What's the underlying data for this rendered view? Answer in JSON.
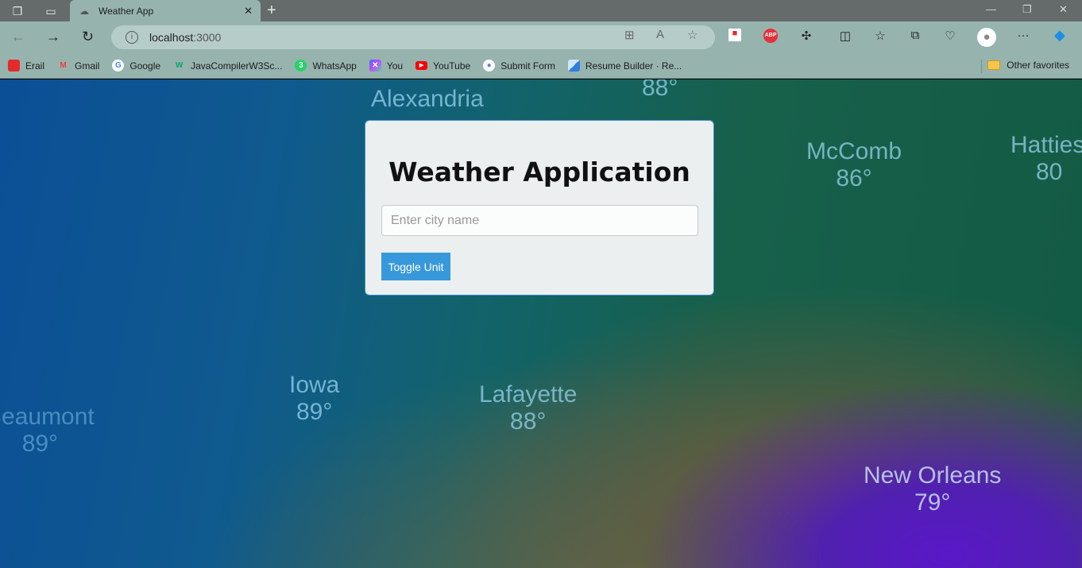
{
  "browser": {
    "tab_title": "Weather App",
    "url_host": "localhost",
    "url_port": ":3000",
    "bookmarks": [
      {
        "label": "Erail",
        "color": "#e32b2b"
      },
      {
        "label": "Gmail",
        "color": "#ea4335"
      },
      {
        "label": "Google",
        "color": "#4285f4"
      },
      {
        "label": "JavaCompilerW3Sc...",
        "color": "#04aa6d"
      },
      {
        "label": "WhatsApp",
        "color": "#25d366"
      },
      {
        "label": "You",
        "color": "#7b4dff"
      },
      {
        "label": "YouTube",
        "color": "#ff0000"
      },
      {
        "label": "Submit Form",
        "color": "#6b7fcf"
      },
      {
        "label": "Resume Builder · Re...",
        "color": "#2f7de1"
      }
    ],
    "other_favorites": "Other favorites"
  },
  "map_labels": [
    {
      "name": "Alexandria",
      "temp": "88°"
    },
    {
      "name": "McComb",
      "temp": "86°"
    },
    {
      "name": "Hatties",
      "temp": "80"
    },
    {
      "name": "Iowa",
      "temp": "89°"
    },
    {
      "name": "Lafayette",
      "temp": "88°"
    },
    {
      "name": "Beaumont",
      "temp": "89°"
    },
    {
      "name": "New Orleans",
      "temp": "79°"
    }
  ],
  "app": {
    "title": "Weather Application",
    "city_placeholder": "Enter city name",
    "city_value": "",
    "toggle_label": "Toggle Unit",
    "accent": "#3898dc"
  }
}
